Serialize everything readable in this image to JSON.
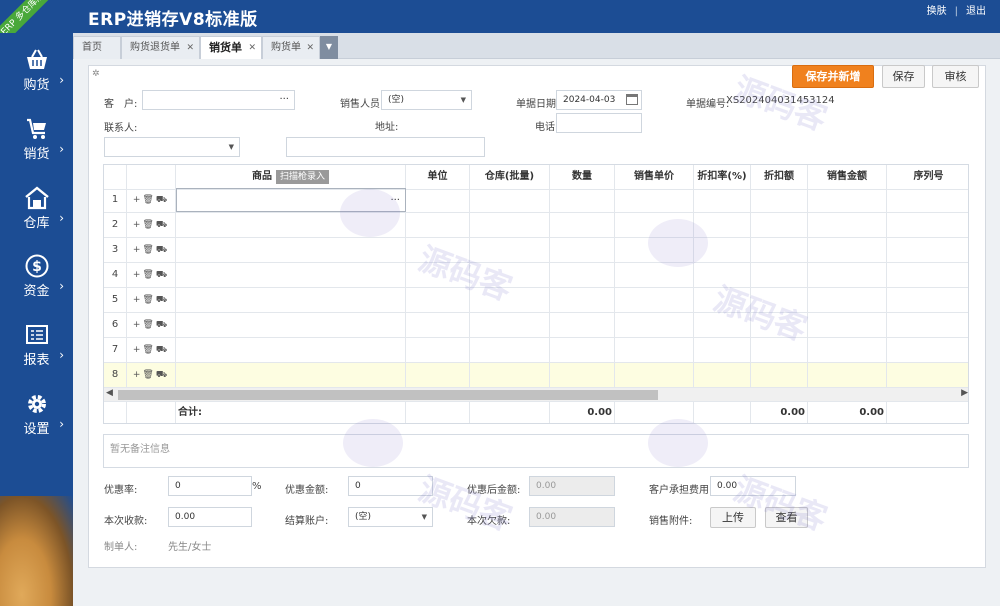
{
  "app": {
    "title": "ERP进销存V8标准版",
    "ribbon": "ERP 多仓库版"
  },
  "header_links": {
    "switch_skin": "换肤",
    "logout": "退出"
  },
  "sidebar": [
    {
      "label": "购货",
      "icon": "basket-icon"
    },
    {
      "label": "销货",
      "icon": "cart-icon"
    },
    {
      "label": "仓库",
      "icon": "warehouse-icon"
    },
    {
      "label": "资金",
      "icon": "dollar-icon"
    },
    {
      "label": "报表",
      "icon": "report-icon"
    },
    {
      "label": "设置",
      "icon": "gear-icon"
    }
  ],
  "tabs": [
    {
      "label": "首页",
      "closable": false,
      "active": false
    },
    {
      "label": "购货退货单",
      "closable": true,
      "active": false
    },
    {
      "label": "销货单",
      "closable": true,
      "active": true
    },
    {
      "label": "购货单",
      "closable": true,
      "active": false
    }
  ],
  "toolbar": {
    "save_new": "保存并新增",
    "save": "保存",
    "audit": "审核"
  },
  "form": {
    "customer_label": "客　户:",
    "salesperson_label": "销售人员:",
    "salesperson_value": "(空)",
    "doc_date_label": "单据日期:",
    "doc_date_value": "2024-04-03",
    "doc_no_label": "单据编号:",
    "doc_no_value": "XS202404031453124",
    "contact_label": "联系人:",
    "address_label": "地址:",
    "phone_label": "电话:"
  },
  "grid": {
    "columns": [
      "商品",
      "单位",
      "仓库(批量)",
      "数量",
      "销售单价",
      "折扣率(%)",
      "折扣额",
      "销售金额",
      "序列号"
    ],
    "scan_label": "扫描枪录入",
    "rows": [
      "1",
      "2",
      "3",
      "4",
      "5",
      "6",
      "7",
      "8"
    ],
    "total_label": "合计:",
    "totals": {
      "quantity": "0.00",
      "discount": "0.00",
      "amount": "0.00"
    }
  },
  "remark_placeholder": "暂无备注信息",
  "footer": {
    "discount_rate_label": "优惠率:",
    "discount_rate_value": "0",
    "percent": "%",
    "discount_amount_label": "优惠金额:",
    "discount_amount_value": "0",
    "after_discount_label": "优惠后金额:",
    "after_discount_value": "0.00",
    "customer_fee_label": "客户承担费用:",
    "customer_fee_value": "0.00",
    "received_label": "本次收款:",
    "received_value": "0.00",
    "account_label": "结算账户:",
    "account_value": "(空)",
    "owed_label": "本次欠款:",
    "owed_value": "0.00",
    "attachment_label": "销售附件:",
    "upload": "上传",
    "view": "查看",
    "creator_label": "制单人:",
    "creator_value": "先生/女士"
  },
  "watermark": {
    "text": "源码客",
    "url": "www.yuandd.net"
  },
  "colors": {
    "brand": "#1c4d94",
    "accent": "#f0811e",
    "highlight": "#fdfde1"
  }
}
